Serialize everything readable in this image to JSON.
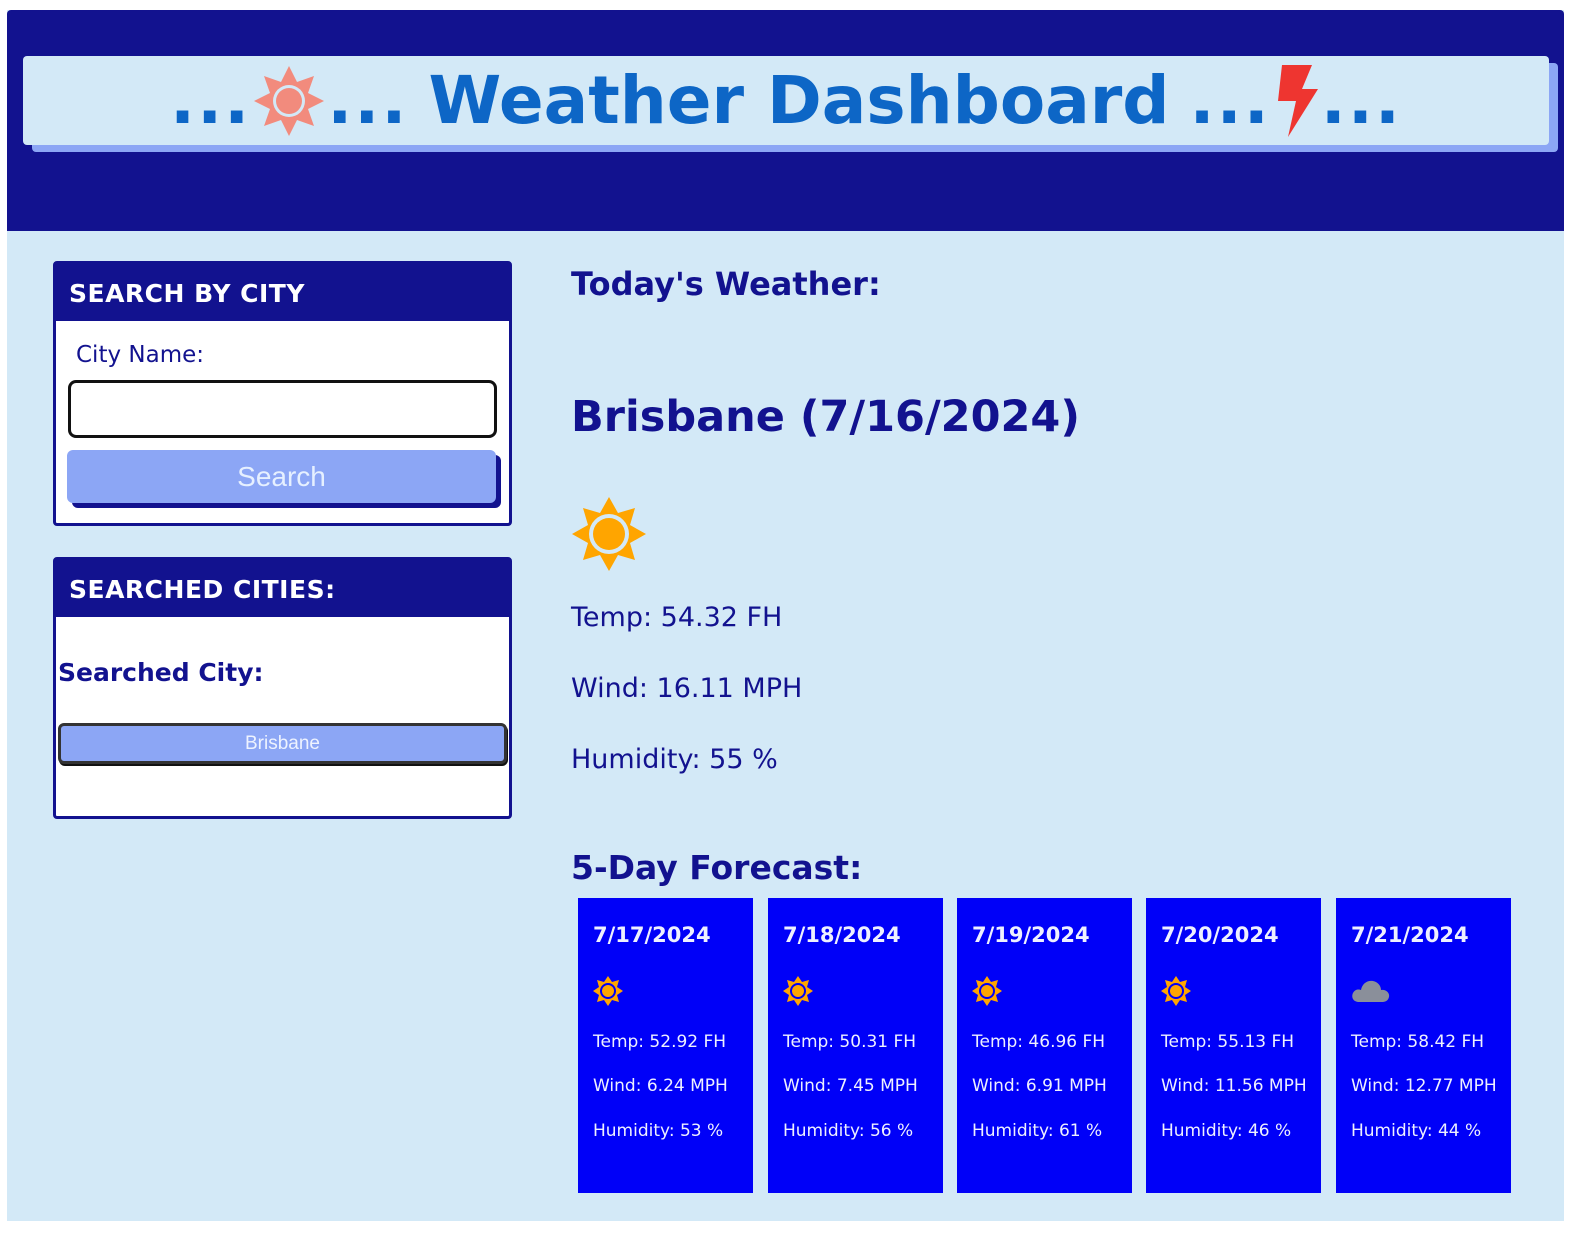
{
  "header": {
    "title": "Weather Dashboard",
    "dots": "...",
    "left_icon": "sun-icon",
    "right_icon": "lightning-icon"
  },
  "search": {
    "heading": "SEARCH BY CITY",
    "city_label": "City Name:",
    "input_value": "",
    "button_label": "Search"
  },
  "history": {
    "heading": "SEARCHED CITIES:",
    "label": "Searched City:",
    "cities": [
      "Brisbane"
    ]
  },
  "today": {
    "heading": "Today's Weather:",
    "title": "Brisbane (7/16/2024)",
    "icon": "sun-icon",
    "temp": "Temp: 54.32 FH",
    "wind": "Wind: 16.11 MPH",
    "humidity": "Humidity: 55 %"
  },
  "forecast": {
    "heading": "5-Day Forecast:",
    "days": [
      {
        "date": "7/17/2024",
        "icon": "sun-icon",
        "temp": "Temp: 52.92 FH",
        "wind": "Wind: 6.24 MPH",
        "humidity": "Humidity: 53 %"
      },
      {
        "date": "7/18/2024",
        "icon": "sun-icon",
        "temp": "Temp: 50.31 FH",
        "wind": "Wind: 7.45 MPH",
        "humidity": "Humidity: 56 %"
      },
      {
        "date": "7/19/2024",
        "icon": "sun-icon",
        "temp": "Temp: 46.96 FH",
        "wind": "Wind: 6.91 MPH",
        "humidity": "Humidity: 61 %"
      },
      {
        "date": "7/20/2024",
        "icon": "sun-icon",
        "temp": "Temp: 55.13 FH",
        "wind": "Wind: 11.56 MPH",
        "humidity": "Humidity: 46 %"
      },
      {
        "date": "7/21/2024",
        "icon": "cloud-icon",
        "temp": "Temp: 58.42 FH",
        "wind": "Wind: 12.77 MPH",
        "humidity": "Humidity: 44 %"
      }
    ]
  },
  "colors": {
    "header_bg": "#12128f",
    "page_bg": "#d3e9f7",
    "title_text": "#0d66c6",
    "button_bg": "#8ca6f5",
    "forecast_card_bg": "#0000f8",
    "sun": "#ffa500",
    "title_sun": "#f28b7d",
    "lightning": "#ee3530",
    "cloud": "#8a8f9a"
  }
}
